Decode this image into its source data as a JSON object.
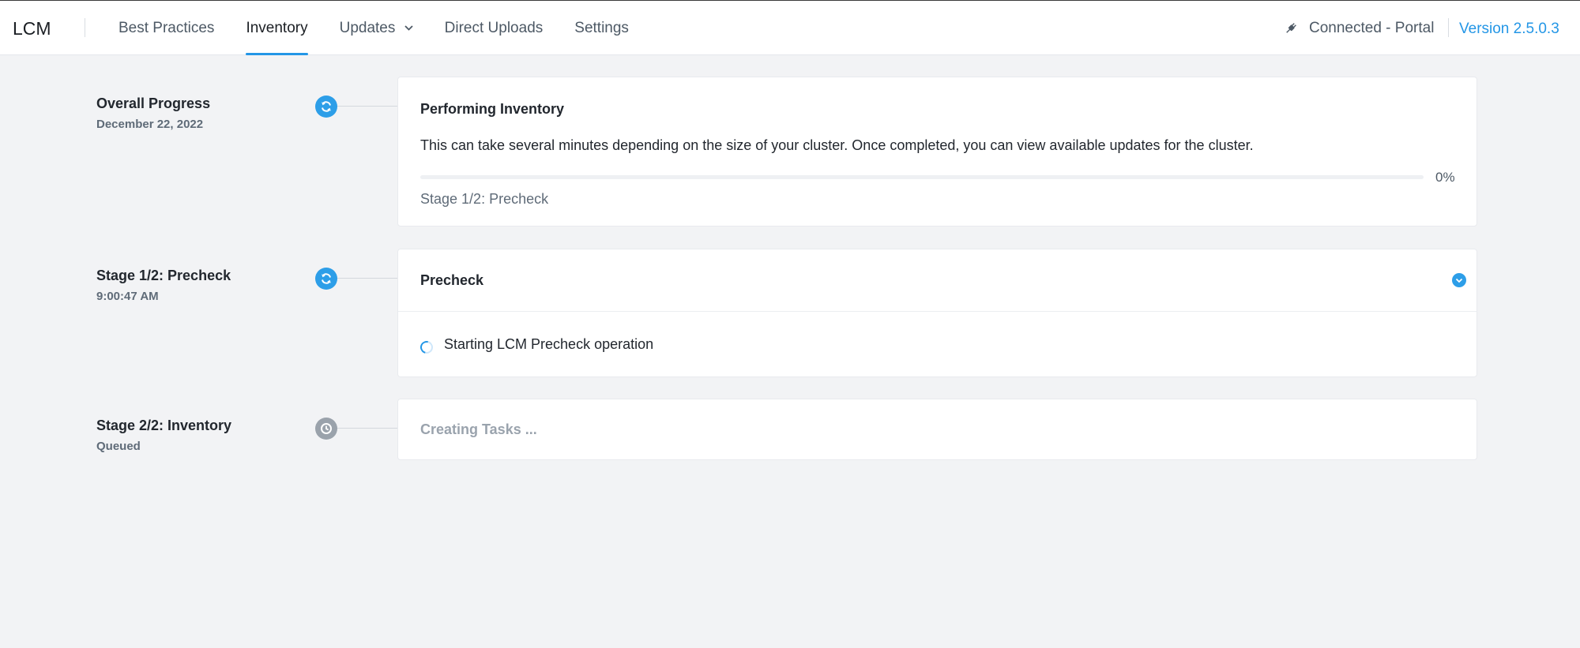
{
  "header": {
    "app_title": "LCM",
    "tabs": [
      {
        "label": "Best Practices"
      },
      {
        "label": "Inventory"
      },
      {
        "label": "Updates"
      },
      {
        "label": "Direct Uploads"
      },
      {
        "label": "Settings"
      }
    ],
    "active_tab": "Inventory",
    "connection_status": "Connected - Portal",
    "version": "Version 2.5.0.3"
  },
  "timeline": {
    "overall": {
      "title": "Overall Progress",
      "date": "December 22, 2022",
      "icon": "sync-icon",
      "card": {
        "title": "Performing Inventory",
        "description": "This can take several minutes depending on the size of your cluster. Once completed, you can view available updates for the cluster.",
        "progress_percent": 0,
        "progress_label": "0%",
        "current_stage": "Stage 1/2: Precheck"
      }
    },
    "precheck": {
      "title": "Stage 1/2: Precheck",
      "time": "9:00:47 AM",
      "icon": "sync-icon",
      "card": {
        "title": "Precheck",
        "task": "Starting LCM Precheck operation"
      }
    },
    "inventory": {
      "title": "Stage 2/2: Inventory",
      "status": "Queued",
      "icon": "clock-icon",
      "card": {
        "text": "Creating Tasks ..."
      }
    }
  },
  "colors": {
    "accent": "#2396e6",
    "background": "#f2f3f5",
    "queued_gray": "#9aa2ab"
  }
}
